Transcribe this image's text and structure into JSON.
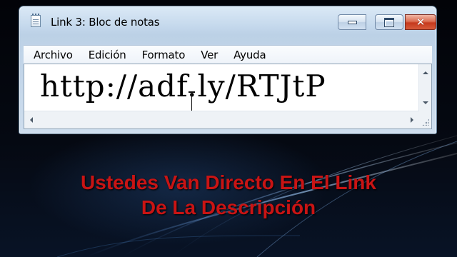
{
  "window": {
    "title": "Link 3: Bloc de notas",
    "controls": {
      "minimize_icon": "minimize-icon",
      "maximize_icon": "maximize-icon",
      "close_icon": "close-icon",
      "close_glyph": "✕"
    }
  },
  "menu": {
    "items": [
      {
        "label": "Archivo"
      },
      {
        "label": "Edición"
      },
      {
        "label": "Formato"
      },
      {
        "label": "Ver"
      },
      {
        "label": "Ayuda"
      }
    ]
  },
  "editor": {
    "content": "http://adf.ly/RTJtP"
  },
  "caption": {
    "line1": "Ustedes Van Directo En El Link",
    "line2": "De La Descripción",
    "color": "#c91414"
  },
  "colors": {
    "desktop_background": "#050912",
    "window_frame": "#c4d8ec",
    "close_button": "#c6391d"
  }
}
